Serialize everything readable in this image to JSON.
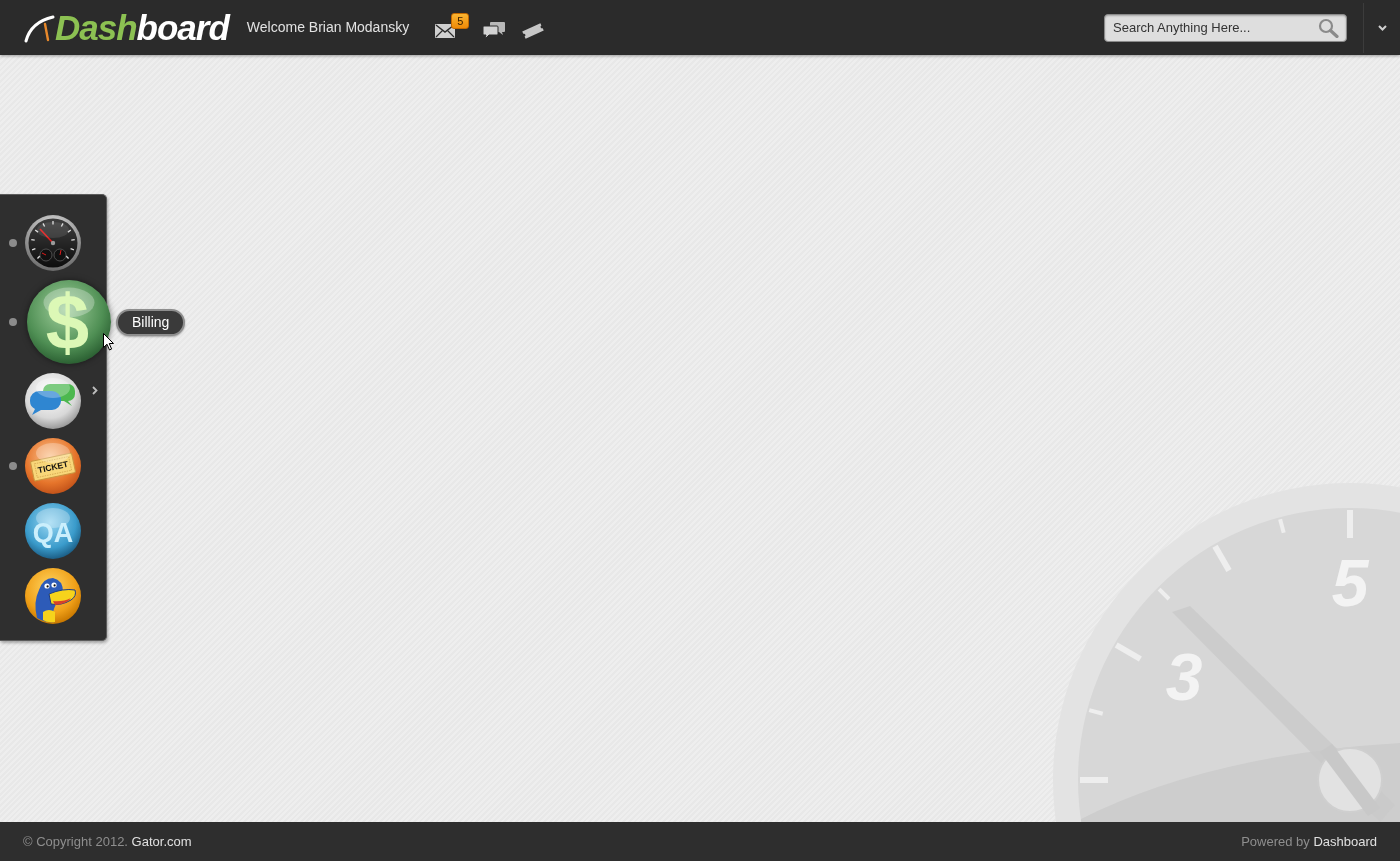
{
  "header": {
    "logo": {
      "accent": "Dash",
      "rest": "board"
    },
    "welcome": "Welcome Brian Modansky",
    "icons": [
      {
        "kind": "mail",
        "badge": "5"
      },
      {
        "kind": "chat"
      },
      {
        "kind": "ticket"
      }
    ],
    "search": {
      "placeholder": "Search Anything Here..."
    }
  },
  "dock": {
    "items": [
      {
        "kind": "gauge",
        "indicator": true,
        "hovered": false,
        "submenu": false
      },
      {
        "kind": "billing",
        "glyph": "$",
        "indicator": true,
        "hovered": true,
        "submenu": false,
        "tooltip": "Billing"
      },
      {
        "kind": "chat",
        "indicator": false,
        "hovered": false,
        "submenu": true
      },
      {
        "kind": "ticket",
        "glyph": "TICKET",
        "indicator": true,
        "hovered": false,
        "submenu": false
      },
      {
        "kind": "qa",
        "glyph": "QA",
        "indicator": false,
        "hovered": false,
        "submenu": false
      },
      {
        "kind": "mascot",
        "indicator": false,
        "hovered": false,
        "submenu": false
      }
    ]
  },
  "background_gauge": {
    "numerals": [
      "3",
      "5"
    ]
  },
  "footer": {
    "copyright": "© Copyright 2012.",
    "site_link": "Gator.com",
    "credit": "Powered by",
    "credit_link": "Dashboard"
  }
}
